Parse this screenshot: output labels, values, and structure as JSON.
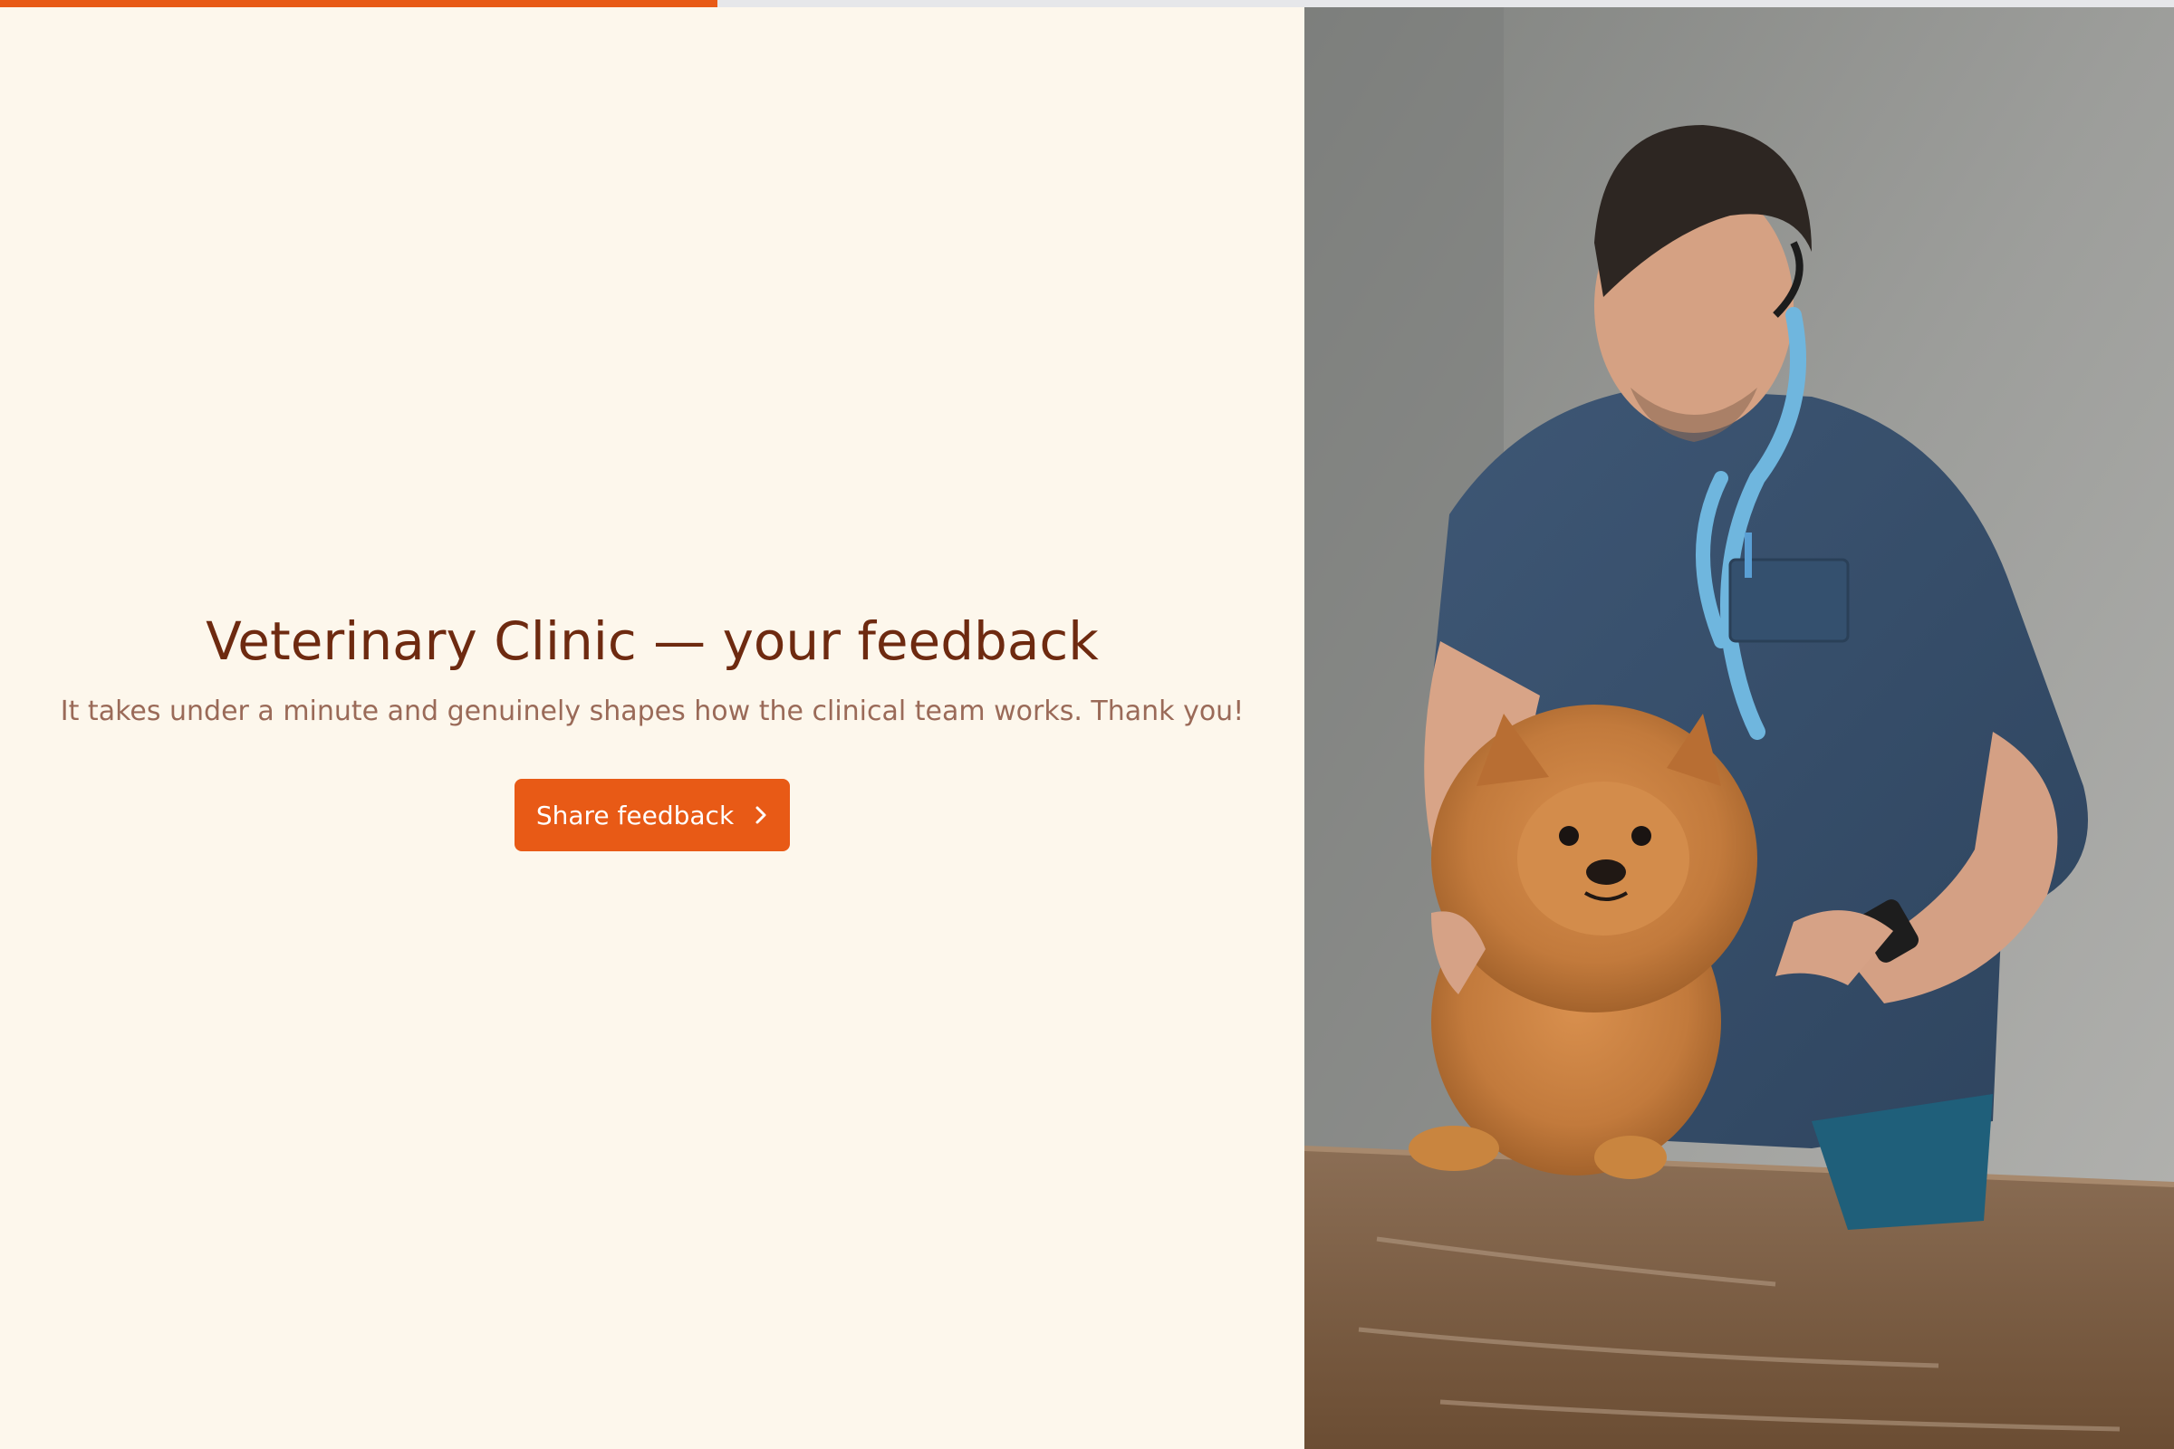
{
  "progress": {
    "value": 0.33
  },
  "hero": {
    "title": "Veterinary Clinic — your feedback",
    "subtitle": "It takes under a minute and genuinely shapes how the clinical team works. Thank you!",
    "cta_label": "Share feedback",
    "cta_icon": "chevron-right-icon"
  },
  "photo": {
    "subject": "veterinarian-with-pomeranian"
  },
  "colors": {
    "accent": "#e85a16",
    "background": "#fdf7ec",
    "title": "#6e2a10",
    "subtitle": "#9a6a58",
    "progress_track": "#e6e7ea"
  }
}
